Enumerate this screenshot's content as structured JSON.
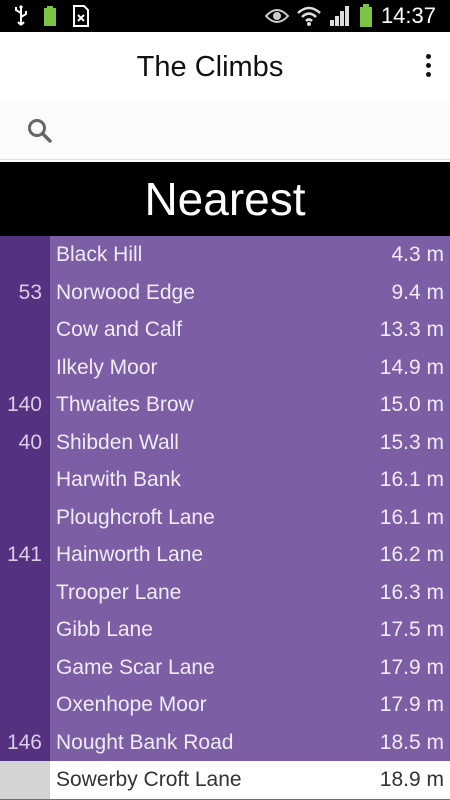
{
  "status_bar": {
    "time": "14:37",
    "icons": [
      "usb-icon",
      "battery-full-icon",
      "sim-error-icon",
      "eye-icon",
      "wifi-icon",
      "signal-icon",
      "battery-icon"
    ]
  },
  "app_bar": {
    "title": "The Climbs",
    "menu_icon": "overflow-menu-icon"
  },
  "search": {
    "icon": "search-icon",
    "value": "",
    "placeholder": ""
  },
  "section": {
    "title": "Nearest"
  },
  "climbs": [
    {
      "rank": "",
      "name": "Black Hill",
      "distance": "4.3 m"
    },
    {
      "rank": "53",
      "name": "Norwood Edge",
      "distance": "9.4 m"
    },
    {
      "rank": "",
      "name": "Cow and Calf",
      "distance": "13.3 m"
    },
    {
      "rank": "",
      "name": "Ilkely Moor",
      "distance": "14.9 m"
    },
    {
      "rank": "140",
      "name": "Thwaites Brow",
      "distance": "15.0 m"
    },
    {
      "rank": "40",
      "name": "Shibden Wall",
      "distance": "15.3 m"
    },
    {
      "rank": "",
      "name": "Harwith Bank",
      "distance": "16.1 m"
    },
    {
      "rank": "",
      "name": "Ploughcroft Lane",
      "distance": "16.1 m"
    },
    {
      "rank": "141",
      "name": "Hainworth Lane",
      "distance": "16.2 m"
    },
    {
      "rank": "",
      "name": "Trooper Lane",
      "distance": "16.3 m"
    },
    {
      "rank": "",
      "name": "Gibb Lane",
      "distance": "17.5 m"
    },
    {
      "rank": "",
      "name": "Game Scar Lane",
      "distance": "17.9 m"
    },
    {
      "rank": "",
      "name": "Oxenhope Moor",
      "distance": "17.9 m"
    },
    {
      "rank": "146",
      "name": "Nought Bank Road",
      "distance": "18.5 m"
    },
    {
      "rank": "",
      "name": "Sowerby Croft Lane",
      "distance": "18.9 m",
      "selected": true
    }
  ],
  "colors": {
    "list_bg": "#7b5ea3",
    "rank_bg": "#55327f",
    "banner_bg": "#000000",
    "selected_bg": "#ffffff",
    "battery": "#7cc443"
  }
}
